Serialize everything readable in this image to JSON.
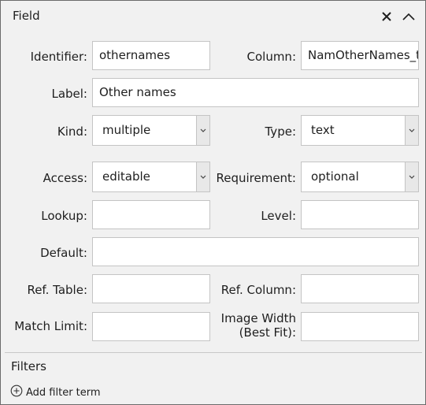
{
  "panel": {
    "title": "Field"
  },
  "fields": {
    "identifier": {
      "label": "Identifier:",
      "value": "othernames"
    },
    "column": {
      "label": "Column:",
      "value": "NamOtherNames_t"
    },
    "label": {
      "label": "Label:",
      "value": "Other names"
    },
    "kind": {
      "label": "Kind:",
      "value": "multiple"
    },
    "type": {
      "label": "Type:",
      "value": "text"
    },
    "access": {
      "label": "Access:",
      "value": "editable"
    },
    "requirement": {
      "label": "Requirement:",
      "value": "optional"
    },
    "lookup": {
      "label": "Lookup:",
      "value": ""
    },
    "level": {
      "label": "Level:",
      "value": ""
    },
    "default": {
      "label": "Default:",
      "value": ""
    },
    "ref_table": {
      "label": "Ref. Table:",
      "value": ""
    },
    "ref_column": {
      "label": "Ref. Column:",
      "value": ""
    },
    "match_limit": {
      "label": "Match Limit:",
      "value": ""
    },
    "image_width": {
      "label_line1": "Image Width",
      "label_line2": "(Best Fit):",
      "value": ""
    }
  },
  "filters": {
    "title": "Filters",
    "add_label": "Add filter term"
  },
  "icons": {
    "close": "close-icon",
    "collapse": "chevron-up-icon",
    "add": "plus-circle-icon",
    "dropdown": "chevron-down-icon"
  }
}
